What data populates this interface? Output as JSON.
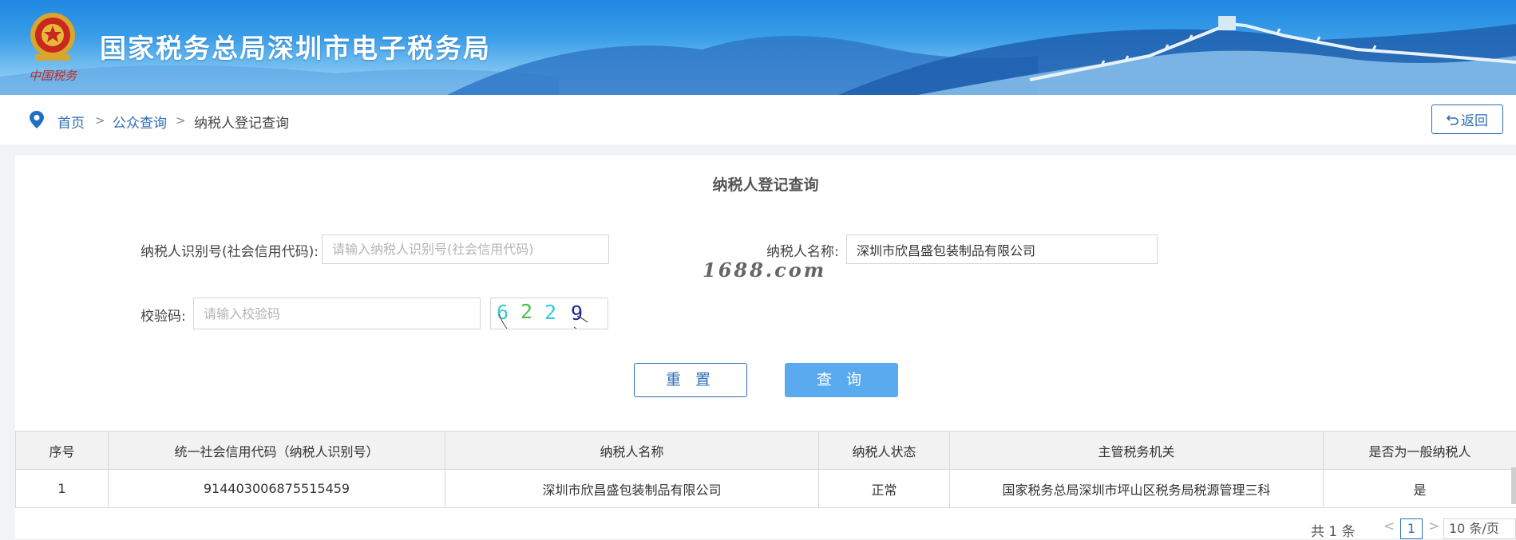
{
  "header": {
    "site_title": "国家税务总局深圳市电子税务局",
    "emblem_caption": "中国税务"
  },
  "breadcrumb": {
    "items": [
      {
        "label": "首页"
      },
      {
        "label": "公众查询"
      },
      {
        "label": "纳税人登记查询"
      }
    ],
    "separator": ">",
    "back_label": "返回"
  },
  "form": {
    "title": "纳税人登记查询",
    "taxpayer_id_label": "纳税人识别号(社会信用代码):",
    "taxpayer_id_placeholder": "请输入纳税人识别号(社会信用代码)",
    "taxpayer_id_value": "",
    "taxpayer_name_label": "纳税人名称:",
    "taxpayer_name_value": "深圳市欣昌盛包装制品有限公司",
    "captcha_label": "校验码:",
    "captcha_placeholder": "请输入校验码",
    "captcha_value": "",
    "captcha_digits": [
      "6",
      "2",
      "2",
      "9"
    ],
    "reset_label": "重 置",
    "query_label": "查 询"
  },
  "watermark": "1688.com",
  "table": {
    "headers": [
      "序号",
      "统一社会信用代码（纳税人识别号）",
      "纳税人名称",
      "纳税人状态",
      "主管税务机关",
      "是否为一般纳税人"
    ],
    "rows": [
      [
        "1",
        "914403006875515459",
        "深圳市欣昌盛包装制品有限公司",
        "正常",
        "国家税务总局深圳市坪山区税务局税源管理三科",
        "是"
      ]
    ]
  },
  "pagination": {
    "total_label": "共 1 条",
    "current_page": "1",
    "prev": "<",
    "next": ">",
    "page_size": "10 条/页"
  },
  "colors": {
    "brand_blue": "#2f6db3",
    "query_button": "#5aaaf0",
    "header_sky": "#1f87e2"
  }
}
